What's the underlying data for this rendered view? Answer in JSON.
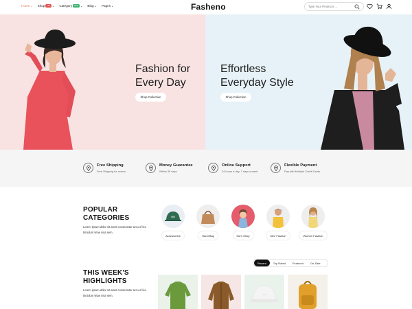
{
  "header": {
    "nav": [
      {
        "label": "Home",
        "active": true
      },
      {
        "label": "Shop",
        "badge": "Hot"
      },
      {
        "label": "Category",
        "badge": "New"
      },
      {
        "label": "Blog"
      },
      {
        "label": "Pages"
      }
    ],
    "logo": "Fasheno",
    "search_placeholder": "Type Your Products ..."
  },
  "hero": {
    "left": {
      "title_line1": "Fashion for",
      "title_line2": "Every Day",
      "button": "Shop Collection"
    },
    "right": {
      "title_line1": "Effortless",
      "title_line2": "Everyday Style",
      "button": "Shop Collection"
    }
  },
  "features": [
    {
      "title": "Free Shipping",
      "subtitle": "Free Shipping for orders",
      "icon": "location-pin-icon"
    },
    {
      "title": "Money Guarantee",
      "subtitle": "Within 30 days",
      "icon": "location-pin-icon"
    },
    {
      "title": "Online Support",
      "subtitle": "24 hours a day, 7 days a week",
      "icon": "location-pin-icon"
    },
    {
      "title": "Flexible Payment",
      "subtitle": "Pay with Multiple Credit Cards",
      "icon": "location-pin-icon"
    }
  ],
  "categories": {
    "title_line1": "POPULAR",
    "title_line2": "CATEGORIES",
    "text_line1": "Lorem ipsum dolor sit amet consectetur arcu of leo",
    "text_line2": "tincidunt vitae nisa sem.",
    "items": [
      "Accessories",
      "Hand Bag",
      "Kid's Shop",
      "Men Fashion",
      "Women Fashion"
    ]
  },
  "highlights": {
    "title_line1": "THIS WEEK'S",
    "title_line2": "HIGHLIGHTS",
    "text_line1": "Lorem ipsum dolor sit amet consectetur arcu of leo",
    "text_line2": "tincidunt vitae nisa sem.",
    "tabs": [
      "Recent",
      "Top Rated",
      "Featured",
      "On-Sale"
    ]
  },
  "colors": {
    "accent": "#e0785a",
    "hero_left_bg": "#f8e3e2",
    "hero_right_bg": "#e6f2f7"
  }
}
